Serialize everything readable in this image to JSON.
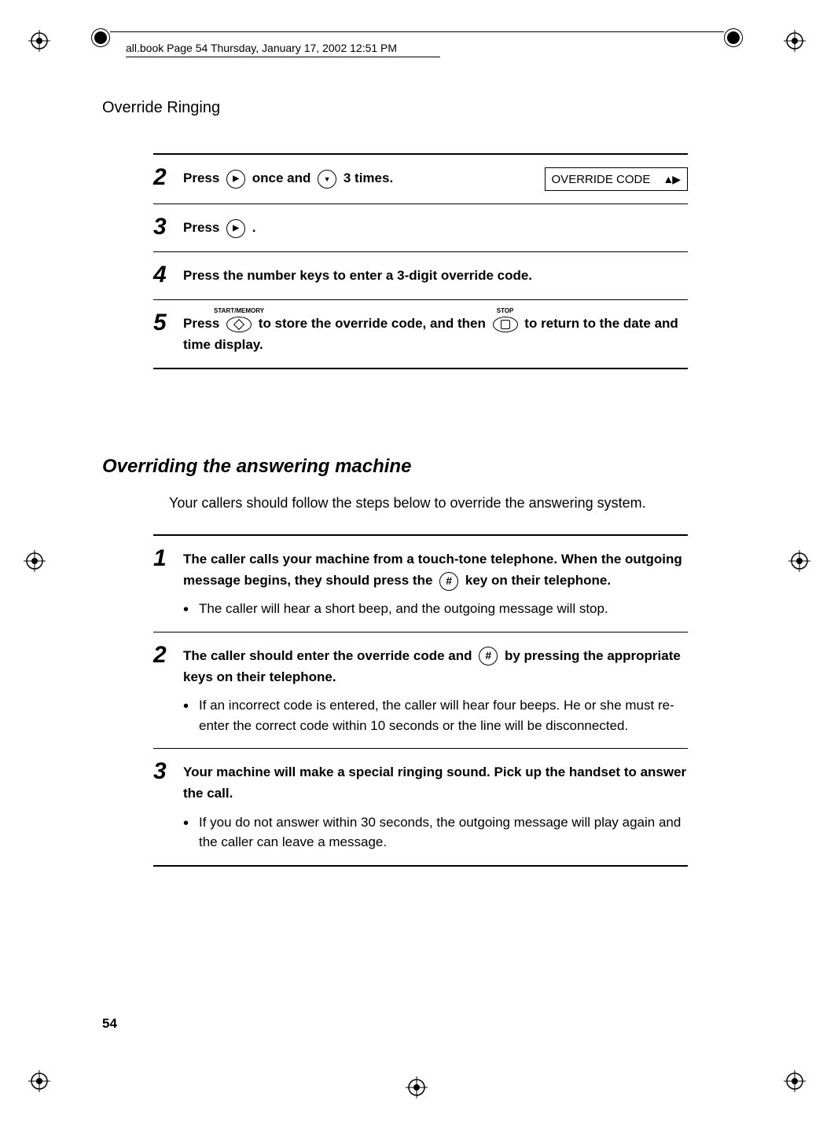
{
  "header": {
    "runningText": "all.book  Page 54  Thursday, January 17, 2002  12:51 PM",
    "sectionTitle": "Override Ringing"
  },
  "stepsA": [
    {
      "num": "2",
      "pre": "Press ",
      "mid1": " once and ",
      "post": " 3 times.",
      "display": "OVERRIDE CODE"
    },
    {
      "num": "3",
      "text": "Press ",
      "post": "."
    },
    {
      "num": "4",
      "text": " Press the number keys to enter a 3-digit override code."
    },
    {
      "num": "5",
      "pre": "Press ",
      "startLabel": "START/MEMORY",
      "mid": " to store the override code, and then ",
      "stopLabel": "STOP",
      "post": " to return to the date and time display."
    }
  ],
  "subheading": "Overriding the answering machine",
  "intro": "Your callers should follow the steps below to override the answering system.",
  "stepsB": [
    {
      "num": "1",
      "line1a": "The caller calls your machine from a touch-tone telephone. When the ",
      "line2a": "outgoing message begins, they should press the ",
      "line2b": " key on their telephone.",
      "bullet": "The caller will hear a short beep, and the outgoing message will stop."
    },
    {
      "num": "2",
      "line1a": "The caller should enter the override code and ",
      "line1b": " by pressing the appropriate keys on their telephone.",
      "bullet": "If an incorrect code is entered, the caller will hear four beeps. He or she must re-enter the correct code within 10 seconds or the line will be disconnected."
    },
    {
      "num": "3",
      "line1": "Your machine will make a special ringing sound. Pick up the handset to answer the call.",
      "bullet": "If you do not answer within 30 seconds, the outgoing message will play again and the caller can leave a message."
    }
  ],
  "pageNumber": "54"
}
